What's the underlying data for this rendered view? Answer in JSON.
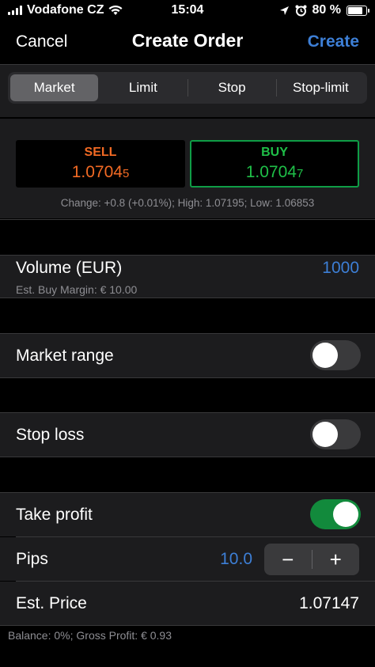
{
  "status": {
    "carrier": "Vodafone CZ",
    "time": "15:04",
    "battery": "80 %",
    "battery_level": 0.8,
    "icons": [
      "signal-icon",
      "wifi-icon",
      "location-icon",
      "alarm-icon",
      "battery-icon"
    ]
  },
  "nav": {
    "cancel": "Cancel",
    "title": "Create Order",
    "create": "Create"
  },
  "tabs": {
    "market": "Market",
    "limit": "Limit",
    "stop": "Stop",
    "stop_limit": "Stop-limit",
    "selected": "Market"
  },
  "quote": {
    "sell_label": "SELL",
    "sell_price_main": "1.0704",
    "sell_price_pip": "5",
    "buy_label": "BUY",
    "buy_price_main": "1.0704",
    "buy_price_pip": "7",
    "change_line": "Change: +0.8 (+0.01%); High: 1.07195; Low: 1.06853"
  },
  "volume": {
    "label": "Volume (EUR)",
    "value": "1000",
    "margin": "Est. Buy Margin: € 10.00"
  },
  "market_range": {
    "label": "Market range",
    "enabled": false
  },
  "stop_loss": {
    "label": "Stop loss",
    "enabled": false
  },
  "take_profit": {
    "label": "Take profit",
    "enabled": true,
    "pips_label": "Pips",
    "pips_value": "10.0",
    "minus": "−",
    "plus": "+",
    "est_price_label": "Est. Price",
    "est_price_value": "1.07147"
  },
  "footer": "Balance: 0%; Gross Profit: € 0.93",
  "colors": {
    "accent_blue": "#3d7fd6",
    "sell_orange": "#f26a24",
    "buy_green": "#1fbf48",
    "toggle_on": "#128a3c"
  }
}
